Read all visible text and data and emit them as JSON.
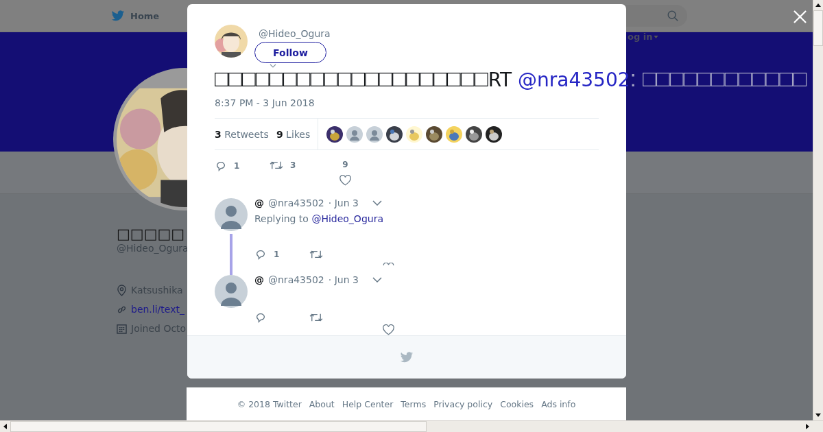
{
  "nav": {
    "home": "Home",
    "login": "og in"
  },
  "profile": {
    "name": "□□□□□",
    "handle": "@Hideo_Ogura",
    "location": "Katsushika",
    "link": "ben.li/text_",
    "joined": "Joined Octo"
  },
  "tweet": {
    "handle": "@Hideo_Ogura",
    "follow": "Follow",
    "text_before": "□□□□□□□□□□□□□□□□□□□□",
    "retweet_prefix": "RT ",
    "mention": "@nra43502",
    "text_after": ": □□□□□□□□□□□□",
    "date": "8:37 PM - 3 Jun 2018",
    "retweets": {
      "count": "3",
      "label": "Retweets"
    },
    "likes": {
      "count": "9",
      "label": "Likes"
    },
    "likers": [
      {
        "kind": "picture"
      },
      {
        "kind": "default"
      },
      {
        "kind": "default"
      },
      {
        "kind": "picture"
      },
      {
        "kind": "picture"
      },
      {
        "kind": "picture"
      },
      {
        "kind": "picture"
      },
      {
        "kind": "picture"
      },
      {
        "kind": "picture"
      }
    ],
    "actions": {
      "replies": "1",
      "retweets": "3",
      "likes": "9"
    }
  },
  "replies": [
    {
      "name": "@",
      "handle": "@nra43502",
      "time": "· Jun 3",
      "replying_label": "Replying to",
      "replying_to": "@Hideo_Ogura",
      "reply_count": "1"
    },
    {
      "name": "@",
      "handle": "@nra43502",
      "time": "· Jun 3"
    }
  ],
  "footer": [
    "© 2018 Twitter",
    "About",
    "Help Center",
    "Terms",
    "Privacy policy",
    "Cookies",
    "Ads info"
  ]
}
